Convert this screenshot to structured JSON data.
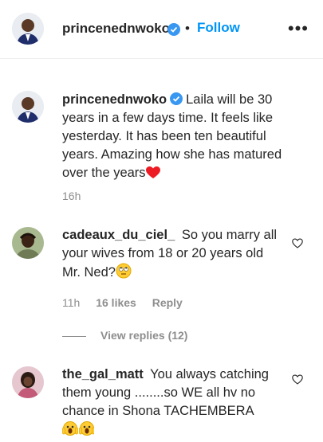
{
  "header": {
    "username": "princenednwoko",
    "separator": "•",
    "follow_label": "Follow",
    "more_label": "•••"
  },
  "caption": {
    "username": "princenednwoko",
    "text": "Laila will be 30 years in a few days time. It feels like yesterday. It has been ten beautiful years. Amazing how she has matured over the years",
    "emoji": "red-heart",
    "time": "16h"
  },
  "comments": [
    {
      "username": "cadeaux_du_ciel_",
      "text": "So you marry all your wives from 18 or 20 years old Mr. Ned?",
      "emoji": "face-with-rolling-eyes",
      "time": "11h",
      "likes": "16 likes",
      "reply_label": "Reply",
      "view_replies": "View replies (12)"
    },
    {
      "username": "the_gal_matt",
      "text": "You always catching them young ........so WE all hv no chance in Shona TACHEMBERA",
      "emoji": "face-screaming-in-fear x2"
    }
  ],
  "colors": {
    "accent": "#0095f6",
    "verified": "#3897f0",
    "muted": "#8e8e8e",
    "heart": "#ed1c24"
  }
}
